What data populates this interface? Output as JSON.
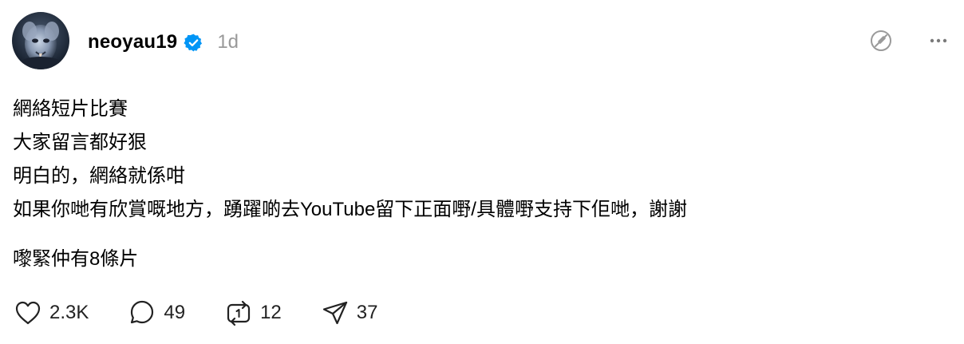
{
  "post": {
    "username": "neoyau19",
    "timestamp": "1d",
    "verified": true,
    "verified_color": "#0095f6",
    "lines": [
      "網絡短片比賽",
      "大家留言都好狠",
      "明白的，網絡就係咁",
      "如果你哋有欣賞嘅地方，踴躍啲去YouTube留下正面嘢/具體嘢支持下佢哋，謝謝"
    ],
    "extra_line": "嚟緊仲有8條片"
  },
  "icons": {
    "avatar": "avatar",
    "verified": "verified-badge-icon",
    "mute_audio": "no-sound-icon",
    "more": "more-options-icon",
    "like": "heart-icon",
    "reply": "comment-icon",
    "repost": "repost-icon",
    "share": "send-icon"
  },
  "actions": {
    "likes": "2.3K",
    "replies": "49",
    "reposts": "12",
    "shares": "37"
  }
}
